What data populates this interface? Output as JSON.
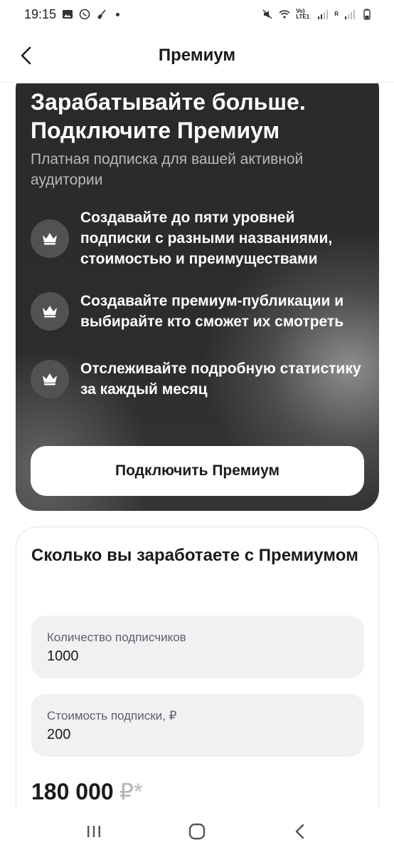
{
  "status_bar": {
    "time": "19:15",
    "network_label": "Vo) LTE1",
    "signal_r": "R"
  },
  "header": {
    "title": "Премиум"
  },
  "promo": {
    "title": "Зарабатывайте больше. Подключите Премиум",
    "subtitle": "Платная подписка для вашей активной аудитории",
    "features": [
      {
        "text": "Создавайте до пяти уровней подписки с разными названиями, стоимостью и преимуществами",
        "icon": "crown-icon"
      },
      {
        "text": "Создавайте премиум-публикации и выбирайте кто сможет их смотреть",
        "icon": "crown-icon"
      },
      {
        "text": "Отслеживайте подробную статистику за каждый месяц",
        "icon": "crown-icon"
      }
    ],
    "cta_label": "Подключить Премиум"
  },
  "calculator": {
    "title": "Сколько вы заработаете с Премиумом",
    "subscribers": {
      "label": "Количество подписчиков",
      "value": "1000"
    },
    "price": {
      "label": "Стоимость подписки, ₽",
      "value": "200"
    },
    "result_amount": "180 000",
    "result_currency": "₽*"
  },
  "colors": {
    "card_dark": "#2c2c2e",
    "accent_white": "#ffffff",
    "field_bg": "#f1f1f3"
  }
}
